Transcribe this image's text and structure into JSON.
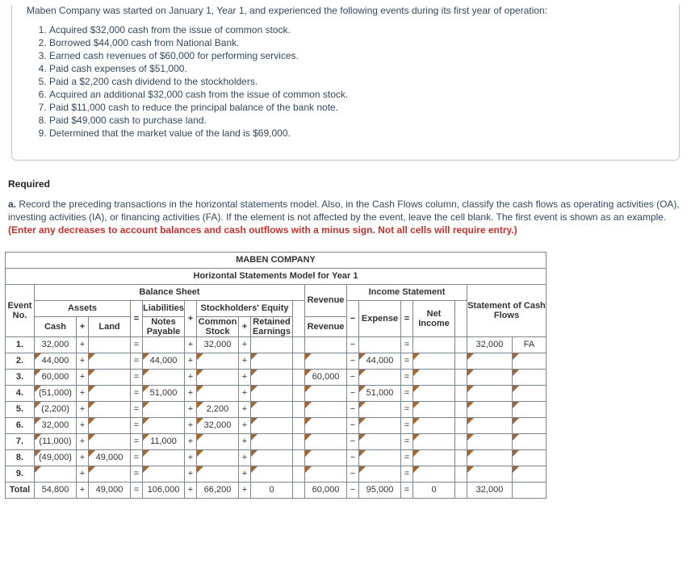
{
  "intro": "Maben Company was started on January 1, Year 1, and experienced the following events during its first year of operation:",
  "events": [
    "Acquired $32,000 cash from the issue of common stock.",
    "Borrowed $44,000 cash from National Bank.",
    "Earned cash revenues of $60,000 for performing services.",
    "Paid cash expenses of $51,000.",
    "Paid a $2,200 cash dividend to the stockholders.",
    "Acquired an additional $32,000 cash from the issue of common stock.",
    "Paid $11,000 cash to reduce the principal balance of the bank note.",
    "Paid $49,000 cash to purchase land.",
    "Determined that the market value of the land is $69,000."
  ],
  "required_heading": "Required",
  "required_label": "a.",
  "required_text_plain": "Record the preceding transactions in the horizontal statements model. Also, in the Cash Flows column, classify the cash flows as operating activities (OA), investing activities (IA), or financing activities (FA). If the element is not affected by the event, leave the cell blank. The first event is shown as an example. ",
  "required_text_red": "(Enter any decreases to account balances and cash outflows with a minus sign. Not all cells will require entry.)",
  "table": {
    "company": "MABEN COMPANY",
    "subtitle": "Horizontal Statements Model for Year 1",
    "headers": {
      "balance_sheet": "Balance Sheet",
      "income_statement": "Income Statement",
      "event_no": "Event No.",
      "assets": "Assets",
      "liabilities": "Liabilities",
      "stockholders_equity": "Stockholders' Equity",
      "cash": "Cash",
      "land": "Land",
      "notes_payable": "Notes Payable",
      "common_stock": "Common Stock",
      "retained_earnings": "Retained Earnings",
      "revenue": "Revenue",
      "expense": "Expense",
      "net_income": "Net Income",
      "cash_flows": "Statement of Cash Flows"
    },
    "rows": [
      {
        "label": "1.",
        "cash": "32,000",
        "land": "",
        "np": "",
        "cs": "32,000",
        "re": "",
        "rev": "",
        "exp": "",
        "ni": "",
        "cf": "32,000",
        "cfa": "FA",
        "edit": false
      },
      {
        "label": "2.",
        "cash": "44,000",
        "land": "",
        "np": "44,000",
        "cs": "",
        "re": "",
        "rev": "",
        "exp": "44,000",
        "ni": "",
        "cf": "",
        "cfa": "",
        "edit": true
      },
      {
        "label": "3.",
        "cash": "60,000",
        "land": "",
        "np": "",
        "cs": "",
        "re": "",
        "rev": "60,000",
        "exp": "",
        "ni": "",
        "cf": "",
        "cfa": "",
        "edit": true
      },
      {
        "label": "4.",
        "cash": "(51,000)",
        "land": "",
        "np": "51,000",
        "cs": "",
        "re": "",
        "rev": "",
        "exp": "51,000",
        "ni": "",
        "cf": "",
        "cfa": "",
        "edit": true
      },
      {
        "label": "5.",
        "cash": "(2,200)",
        "land": "",
        "np": "",
        "cs": "2,200",
        "re": "",
        "rev": "",
        "exp": "",
        "ni": "",
        "cf": "",
        "cfa": "",
        "edit": true
      },
      {
        "label": "6.",
        "cash": "32,000",
        "land": "",
        "np": "",
        "cs": "32,000",
        "re": "",
        "rev": "",
        "exp": "",
        "ni": "",
        "cf": "",
        "cfa": "",
        "edit": true
      },
      {
        "label": "7.",
        "cash": "(11,000)",
        "land": "",
        "np": "11,000",
        "cs": "",
        "re": "",
        "rev": "",
        "exp": "",
        "ni": "",
        "cf": "",
        "cfa": "",
        "edit": true
      },
      {
        "label": "8.",
        "cash": "(49,000)",
        "land": "49,000",
        "np": "",
        "cs": "",
        "re": "",
        "rev": "",
        "exp": "",
        "ni": "",
        "cf": "",
        "cfa": "",
        "edit": true
      },
      {
        "label": "9.",
        "cash": "",
        "land": "",
        "np": "",
        "cs": "",
        "re": "",
        "rev": "",
        "exp": "",
        "ni": "",
        "cf": "",
        "cfa": "",
        "edit": true
      }
    ],
    "total": {
      "label": "Total",
      "cash": "54,800",
      "land": "49,000",
      "np": "106,000",
      "cs": "66,200",
      "re": "0",
      "rev": "60,000",
      "exp": "95,000",
      "ni": "0",
      "cf": "32,000",
      "cfa": ""
    }
  }
}
